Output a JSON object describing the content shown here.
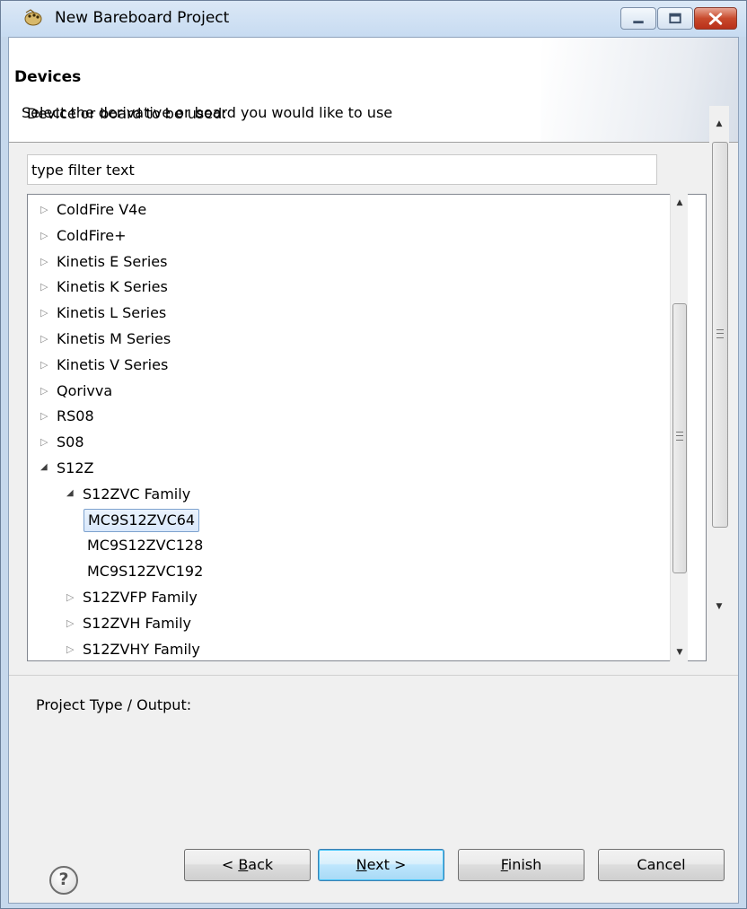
{
  "window": {
    "title": "New Bareboard Project",
    "controls": [
      "minimize",
      "maximize",
      "close"
    ]
  },
  "header": {
    "title": "Devices",
    "description": "Select the derivative or board you would like to use"
  },
  "device_section": {
    "label": "Device or board to be used:",
    "filter_value": "type filter text"
  },
  "tree": {
    "items": [
      {
        "label": "ColdFire V4e",
        "state": "collapsed",
        "level": 0
      },
      {
        "label": "ColdFire+",
        "state": "collapsed",
        "level": 0
      },
      {
        "label": "Kinetis E Series",
        "state": "collapsed",
        "level": 0
      },
      {
        "label": "Kinetis K Series",
        "state": "collapsed",
        "level": 0
      },
      {
        "label": "Kinetis L Series",
        "state": "collapsed",
        "level": 0
      },
      {
        "label": "Kinetis M Series",
        "state": "collapsed",
        "level": 0
      },
      {
        "label": "Kinetis V Series",
        "state": "collapsed",
        "level": 0
      },
      {
        "label": "Qorivva",
        "state": "collapsed",
        "level": 0
      },
      {
        "label": "RS08",
        "state": "collapsed",
        "level": 0
      },
      {
        "label": "S08",
        "state": "collapsed",
        "level": 0
      },
      {
        "label": "S12Z",
        "state": "expanded",
        "level": 0
      },
      {
        "label": "S12ZVC Family",
        "state": "expanded",
        "level": 1
      },
      {
        "label": "MC9S12ZVC64",
        "state": "leaf",
        "level": 2,
        "selected": true
      },
      {
        "label": "MC9S12ZVC128",
        "state": "leaf",
        "level": 2
      },
      {
        "label": "MC9S12ZVC192",
        "state": "leaf",
        "level": 2
      },
      {
        "label": "S12ZVFP Family",
        "state": "collapsed",
        "level": 1
      },
      {
        "label": "S12ZVH Family",
        "state": "collapsed",
        "level": 1
      },
      {
        "label": "S12ZVHY Family",
        "state": "collapsed",
        "level": 1
      }
    ]
  },
  "project_section": {
    "label": "Project Type / Output:"
  },
  "buttons": {
    "help": "?",
    "back": {
      "pre": "< ",
      "mn": "B",
      "post": "ack"
    },
    "next": {
      "pre": "",
      "mn": "N",
      "post": "ext >"
    },
    "finish": {
      "pre": "",
      "mn": "F",
      "post": "inish"
    },
    "cancel": "Cancel"
  },
  "colors": {
    "selection_border": "#7da2ce",
    "default_button_border": "#3c7fb1",
    "close_button": "#c84a2d"
  }
}
